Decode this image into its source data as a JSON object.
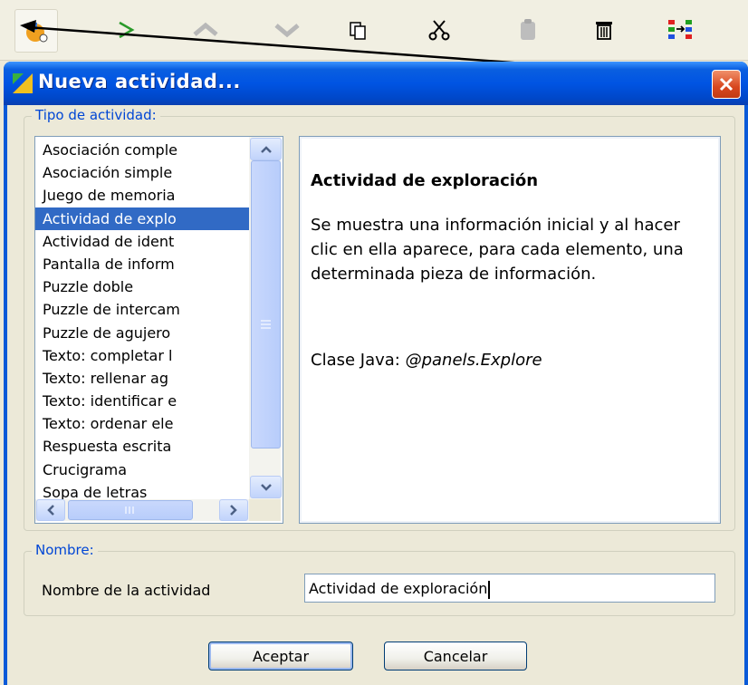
{
  "toolbar": {
    "icons": [
      "new-activity-icon",
      "play-icon",
      "move-up-icon",
      "move-down-icon",
      "copy-icon",
      "cut-icon",
      "paste-icon",
      "delete-icon",
      "sort-icon"
    ]
  },
  "dialog": {
    "title": "Nueva actividad...",
    "tipo_legend": "Tipo de actividad:",
    "activity_types": [
      "Asociación comple",
      "Asociación simple",
      "Juego de memoria",
      "Actividad de explo",
      "Actividad de ident",
      "Pantalla de inform",
      "Puzzle doble",
      "Puzzle de intercam",
      "Puzzle de agujero",
      "Texto: completar l",
      "Texto: rellenar ag",
      "Texto: identificar e",
      "Texto: ordenar ele",
      "Respuesta escrita",
      "Crucigrama",
      "Sopa de letras"
    ],
    "selected_index": 3,
    "description": {
      "title": "Actividad de exploración",
      "body": "Se muestra una información inicial y al hacer clic en ella aparece, para cada elemento, una determinada pieza de información.",
      "class_prefix": "Clase Java: ",
      "class_name": "@panels.Explore"
    },
    "nombre_legend": "Nombre:",
    "name_label": "Nombre de la actividad",
    "name_value": "Actividad de exploración",
    "ok_label": "Aceptar",
    "cancel_label": "Cancelar"
  }
}
